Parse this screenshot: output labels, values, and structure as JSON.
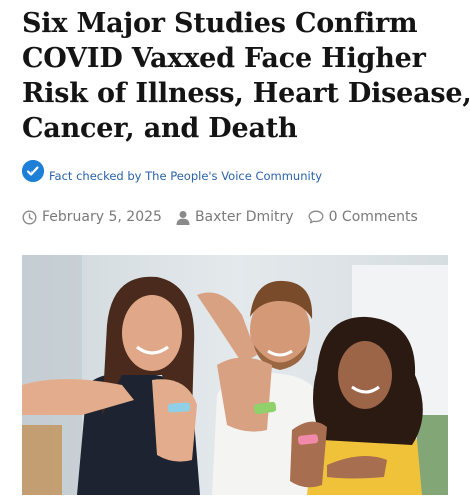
{
  "article": {
    "headline_lines": [
      "Six Major Studies Confirm",
      "COVID Vaxxed Face Higher",
      "Risk of Illness, Heart Disease,",
      "Cancer, and Death"
    ],
    "fact_check_text": "Fact checked by The People's Voice Community",
    "date": "February 5, 2025",
    "author": "Baxter Dmitry",
    "comments": "0 Comments"
  },
  "icons": {
    "fact_check": "verified-check-icon",
    "date": "clock-icon",
    "author": "user-icon",
    "comments": "comment-bubble-icon"
  },
  "colors": {
    "badge": "#1e7fd6",
    "fact_check_text": "#2a63a8",
    "meta_text": "#7a7a7a"
  }
}
